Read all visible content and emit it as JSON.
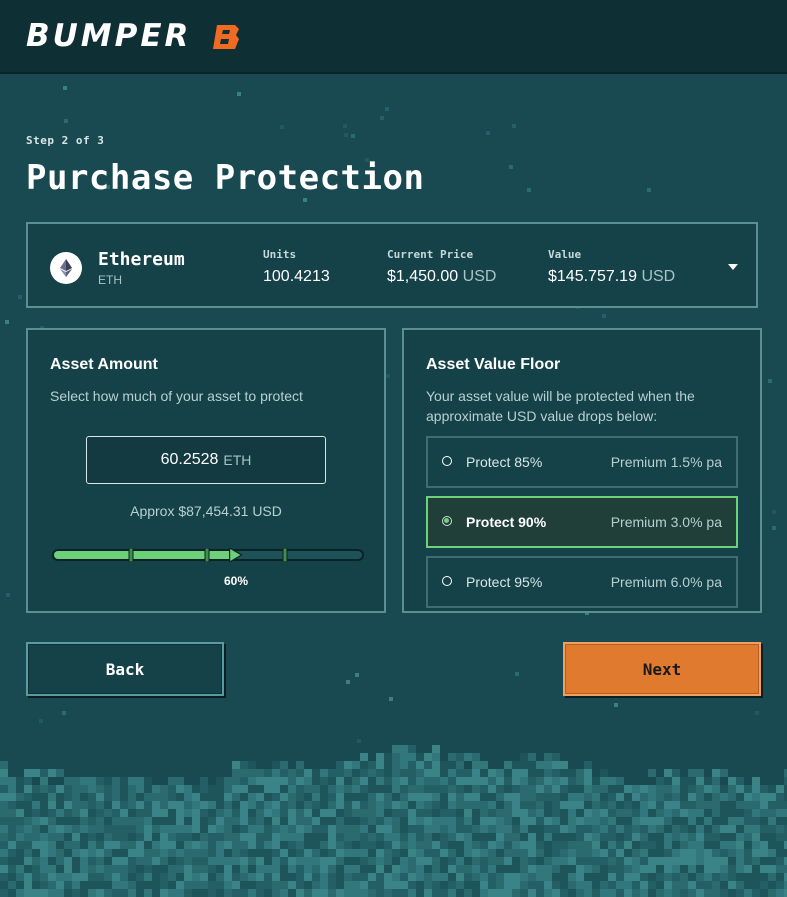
{
  "header": {
    "brand": "BUMPER",
    "logo_icon": "bumper-b-logo-icon",
    "brand_color": "#f06a22"
  },
  "step_text": "Step 2 of 3",
  "page_title": "Purchase Protection",
  "asset": {
    "name": "Ethereum",
    "symbol": "ETH",
    "icon": "ethereum-icon",
    "units_label": "Units",
    "units_value": "100.4213",
    "price_label": "Current Price",
    "price_value": "$1,450.00",
    "price_unit": "USD",
    "value_label": "Value",
    "value_value": "$145.757.19",
    "value_unit": "USD"
  },
  "asset_amount": {
    "title": "Asset Amount",
    "description": "Select how much of your asset to protect",
    "amount": "60.2528",
    "amount_unit": "ETH",
    "approx_text": "Approx $87,454.31 USD",
    "slider_percent_label": "60%",
    "slider_value": 0.6,
    "slider_color": "#6fd07a"
  },
  "value_floor": {
    "title": "Asset Value Floor",
    "description": "Your asset value will be protected when the approximate USD value drops below:",
    "options": [
      {
        "label": "Protect 85%",
        "premium": "Premium 1.5% pa",
        "selected": false
      },
      {
        "label": "Protect 90%",
        "premium": "Premium 3.0% pa",
        "selected": true
      },
      {
        "label": "Protect 95%",
        "premium": "Premium 6.0% pa",
        "selected": false
      }
    ]
  },
  "buttons": {
    "back": "Back",
    "next": "Next"
  },
  "colors": {
    "background": "#1a4a51",
    "header": "#0e2f33",
    "accent_orange": "#e07a2e",
    "accent_green": "#6fd07a"
  }
}
